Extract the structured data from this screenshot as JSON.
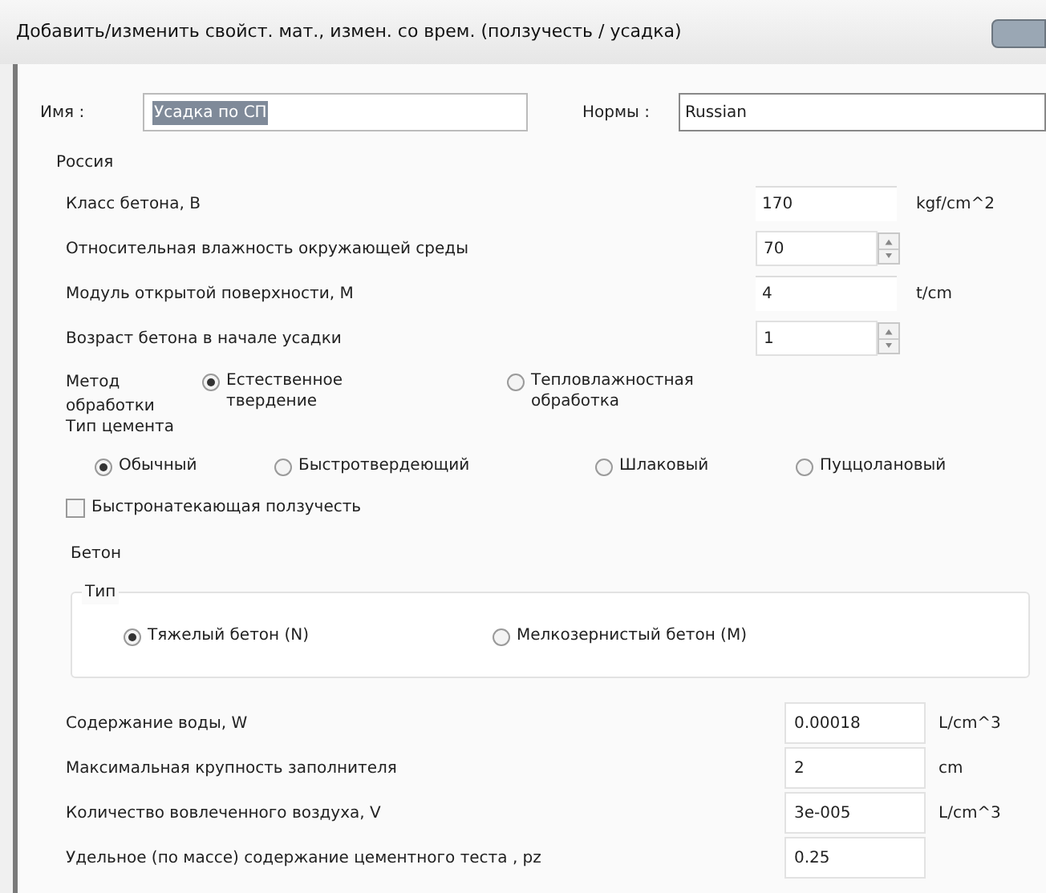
{
  "window": {
    "title": "Добавить/изменить свойст. мат., измен. со врем. (ползучесть / усадка)"
  },
  "name": {
    "label": "Имя :",
    "value": "Усадка по СП"
  },
  "norms": {
    "label": "Нормы :",
    "value": "Russian"
  },
  "group": {
    "title": "Россия",
    "fields": [
      {
        "kind": "input",
        "label": "Класс бетона, B",
        "value": "170",
        "unit": "kgf/cm^2"
      },
      {
        "kind": "spin",
        "label": "Относительная влажность окружающей среды",
        "value": "70"
      },
      {
        "kind": "input",
        "label": "Модуль открытой поверхности, M",
        "value": "4",
        "unit": "t/cm"
      },
      {
        "kind": "spin",
        "label": "Возраст бетона в начале усадки",
        "value": "1"
      }
    ],
    "method": {
      "label": "Метод обработки",
      "options": [
        {
          "label": "Естественное твердение",
          "selected": true
        },
        {
          "label": "Тепловлажностная обработка",
          "selected": false
        }
      ]
    },
    "cement": {
      "label": "Тип цемента",
      "options": [
        {
          "label": "Обычный",
          "selected": true
        },
        {
          "label": "Быстротвердеющий",
          "selected": false
        },
        {
          "label": "Шлаковый",
          "selected": false
        },
        {
          "label": "Пуццолановый",
          "selected": false
        }
      ]
    },
    "fast_creep": {
      "label": "Быстронатекающая ползучесть",
      "checked": false
    },
    "concrete": {
      "title": "Бетон",
      "type_title": "Тип",
      "options": [
        {
          "label": "Тяжелый бетон (N)",
          "selected": true
        },
        {
          "label": "Мелкозернистый бетон (M)",
          "selected": false
        }
      ]
    },
    "params": [
      {
        "label": "Содержание воды, W",
        "value": "0.00018",
        "unit": "L/cm^3"
      },
      {
        "label": "Максимальная крупность заполнителя",
        "value": "2",
        "unit": "cm"
      },
      {
        "label": "Количество вовлеченного воздуха, V",
        "value": "3e-005",
        "unit": "L/cm^3"
      },
      {
        "label": "Удельное (по массе) содержание цементного теста , pz",
        "value": "0.25"
      }
    ]
  }
}
